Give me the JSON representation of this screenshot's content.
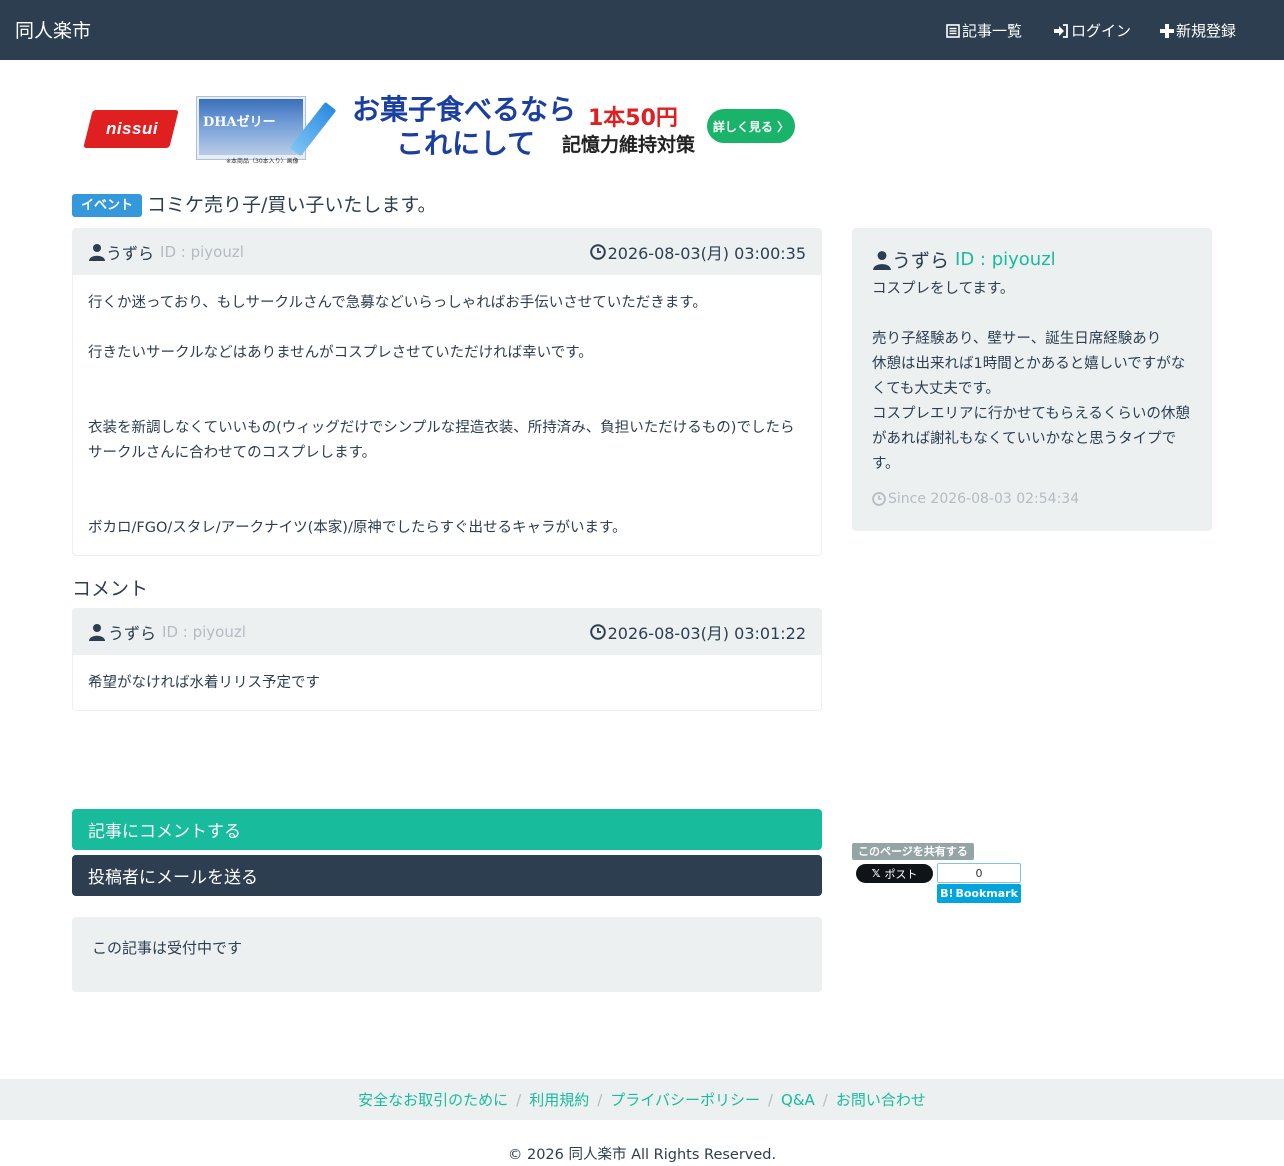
{
  "navbar": {
    "brand": "同人楽市",
    "items": [
      {
        "label": "記事一覧",
        "icon": "list-icon"
      },
      {
        "label": "ログイン",
        "icon": "login-icon"
      },
      {
        "label": "新規登録",
        "icon": "plus-icon"
      }
    ]
  },
  "ad": {
    "logo": "nissui",
    "product_name": "DHAゼリー",
    "product_note": "※本商品（30本入り）画像",
    "headline_1": "お菓子食べるなら",
    "headline_2": "これにして",
    "price": "1本50円",
    "subcopy": "記憶力維持対策",
    "button": "詳しく見る 〉"
  },
  "article": {
    "badge": "イベント",
    "title": "コミケ売り子/買い子いたします。",
    "author": "うずら",
    "author_id": "ID : piyouzl",
    "date": "2026-08-03(月) 03:00:35",
    "body": {
      "p1": "行くか迷っており、もしサークルさんで急募などいらっしゃればお手伝いさせていただきます。",
      "p2": "行きたいサークルなどはありませんがコスプレさせていただければ幸いです。",
      "p3": "衣装を新調しなくていいもの(ウィッグだけでシンプルな捏造衣装、所持済み、負担いただけるもの)でしたらサークルさんに合わせてのコスプレします。",
      "p4": "ボカロ/FGO/スタレ/アークナイツ(本家)/原神でしたらすぐ出せるキャラがいます。"
    }
  },
  "comments": {
    "heading": "コメント",
    "items": [
      {
        "author": "うずら",
        "author_id": "ID : piyouzl",
        "date": "2026-08-03(月) 03:01:22",
        "text": "希望がなければ水着リリス予定です"
      }
    ]
  },
  "actions": {
    "comment_button": "記事にコメントする",
    "mail_button": "投稿者にメールを送る",
    "status": "この記事は受付中です"
  },
  "profile": {
    "name": "うずら",
    "id": "ID : piyouzl",
    "line1": "コスプレをしてます。",
    "line2": "売り子経験あり、壁サー、誕生日席経験あり",
    "line3": "休憩は出来れば1時間とかあると嬉しいですがなくても大丈夫です。",
    "line4": "コスプレエリアに行かせてもらえるくらいの休憩があれば謝礼もなくていいかなと思うタイプです。",
    "since": "Since 2026-08-03 02:54:34"
  },
  "share": {
    "label": "このページを共有する",
    "x_post": "ポスト",
    "hatena_count": "0",
    "hatena_label": "Bookmark"
  },
  "footer": {
    "links": [
      "安全なお取引のために",
      "利用規約",
      "プライバシーポリシー",
      "Q&A",
      "お問い合わせ"
    ],
    "copyright": "© 2026 同人楽市 All Rights Reserved."
  },
  "colors": {
    "navbar": "#2c3e50",
    "accent": "#18bc9c",
    "badge": "#3498db",
    "panel": "#ecf0f1"
  }
}
